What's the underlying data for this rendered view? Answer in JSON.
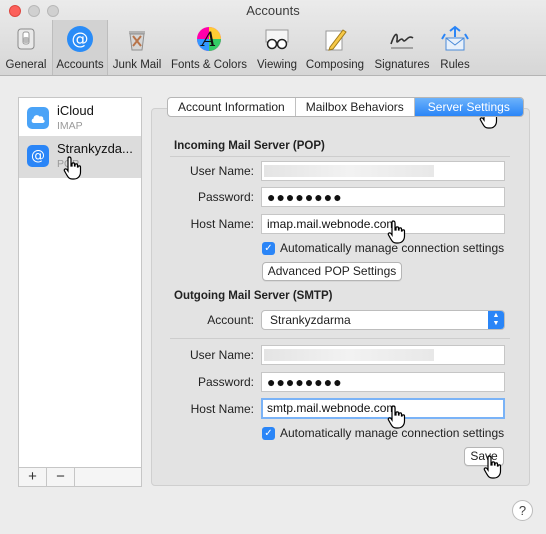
{
  "window": {
    "title": "Accounts"
  },
  "toolbar": {
    "items": [
      {
        "label": "General",
        "icon": "general-switch-icon"
      },
      {
        "label": "Accounts",
        "icon": "at-sign-icon",
        "active": true
      },
      {
        "label": "Junk Mail",
        "icon": "trash-bin-icon"
      },
      {
        "label": "Fonts & Colors",
        "icon": "font-palette-icon"
      },
      {
        "label": "Viewing",
        "icon": "glasses-icon"
      },
      {
        "label": "Composing",
        "icon": "pencil-paper-icon"
      },
      {
        "label": "Signatures",
        "icon": "signature-icon"
      },
      {
        "label": "Rules",
        "icon": "rules-envelope-icon"
      }
    ]
  },
  "accounts": [
    {
      "name": "iCloud",
      "type": "IMAP",
      "icon": "cloud-icon"
    },
    {
      "name": "Strankyzda...",
      "type": "POP",
      "icon": "at-sign-icon",
      "selected": true
    }
  ],
  "list_footer": {
    "add": "+",
    "remove": "−"
  },
  "tabs": [
    {
      "label": "Account Information"
    },
    {
      "label": "Mailbox Behaviors"
    },
    {
      "label": "Server Settings",
      "active": true
    }
  ],
  "incoming": {
    "title": "Incoming Mail Server (POP)",
    "user_name_label": "User Name:",
    "user_name_value": "",
    "password_label": "Password:",
    "password_value": "●●●●●●●●",
    "host_label": "Host Name:",
    "host_value": "imap.mail.webnode.com",
    "auto_manage": "Automatically manage connection settings",
    "advanced_button": "Advanced POP Settings"
  },
  "outgoing": {
    "title": "Outgoing Mail Server (SMTP)",
    "account_label": "Account:",
    "account_value": "Strankyzdarma",
    "user_name_label": "User Name:",
    "user_name_value": "",
    "password_label": "Password:",
    "password_value": "●●●●●●●●",
    "host_label": "Host Name:",
    "host_value": "smtp.mail.webnode.com",
    "auto_manage": "Automatically manage connection settings"
  },
  "save_button": "Save",
  "help": "?",
  "colors": {
    "accent": "#2a85f7",
    "close": "#fc605b"
  }
}
